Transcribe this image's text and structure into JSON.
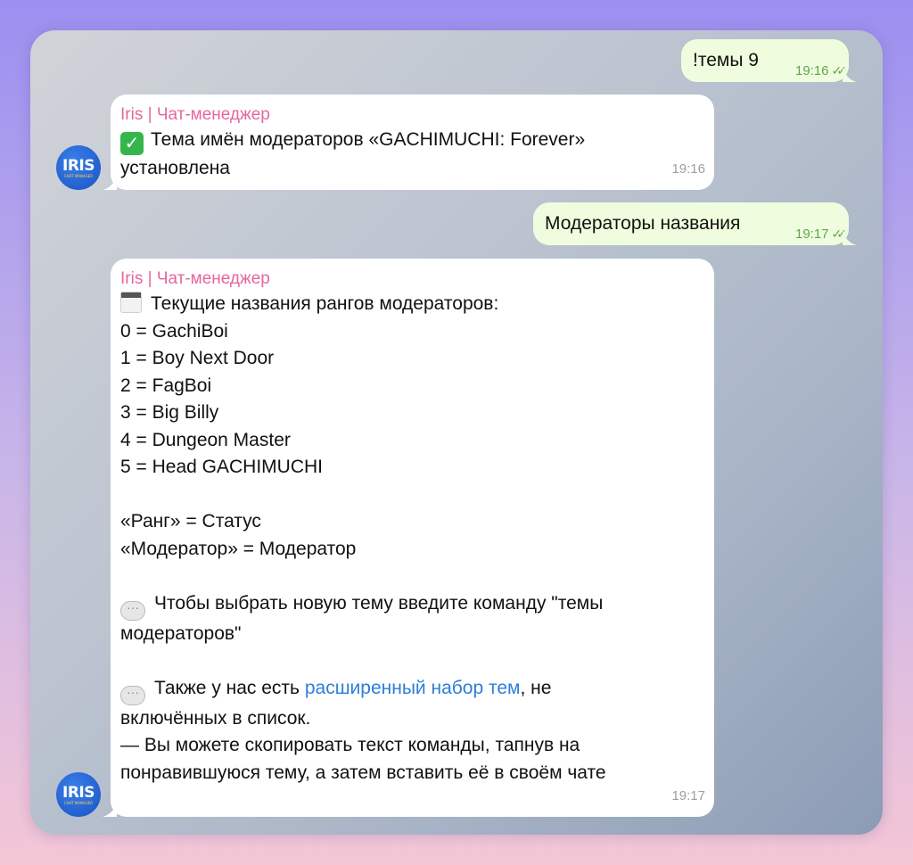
{
  "chat": {
    "messages": [
      {
        "direction": "out",
        "text": "!темы 9",
        "time": "19:16",
        "status": "read"
      },
      {
        "direction": "in",
        "sender": "Iris | Чат-менеджер",
        "lines": [
          "Тема имён модераторов «GACHIMUCHI: Forever»",
          "установлена"
        ],
        "time": "19:16"
      },
      {
        "direction": "out",
        "text": "Модераторы названия",
        "time": "19:17",
        "status": "read"
      },
      {
        "direction": "in",
        "sender": "Iris | Чат-менеджер",
        "header": "Текущие названия рангов модераторов:",
        "ranks": [
          "0 = GachiBoi",
          "1 = Boy Next Door",
          "2 = FagBoi",
          "3 = Big Billy",
          "4 = Dungeon Master",
          "5 = Head GACHIMUCHI"
        ],
        "mapping": [
          "«Ранг» = Статус",
          "«Модератор» = Модератор"
        ],
        "hint": [
          "Чтобы выбрать новую тему введите команду \"темы",
          "модераторов\""
        ],
        "extra_prefix": "Также у нас есть ",
        "extra_link": "расширенный набор тем",
        "extra_suffix": ", не",
        "extra_line2": "включённых в список.",
        "copy": [
          "— Вы можете скопировать текст команды, тапнув на",
          "понравившуюся тему, а затем вставить её в своём чате"
        ],
        "time": "19:17"
      }
    ]
  },
  "avatar": {
    "logo": "IRIS",
    "sub": "CHAT MANAGER"
  },
  "icons": {
    "read_status": "double-check-icon",
    "check_emoji": "check-mark-button-emoji",
    "calendar_emoji": "tear-off-calendar-emoji",
    "speech_emoji": "speech-balloon-emoji"
  },
  "colors": {
    "outgoing_bubble": "#effdde",
    "incoming_bubble": "#ffffff",
    "sender_name": "#e5679c",
    "link": "#2e7fd6",
    "time_outgoing": "#5fa54f"
  }
}
